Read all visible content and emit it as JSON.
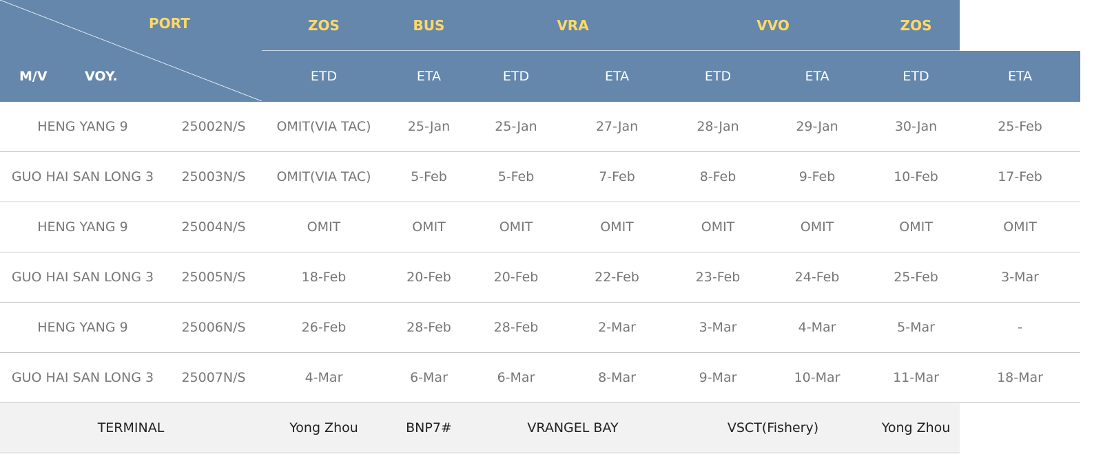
{
  "header": {
    "port_label": "PORT",
    "mv_label": "M/V",
    "voy_label": "VOY.",
    "ports": [
      {
        "code": "ZOS",
        "span": 1
      },
      {
        "code": "BUS",
        "span": 1
      },
      {
        "code": "VRA",
        "span": 2
      },
      {
        "code": "VVO",
        "span": 2
      },
      {
        "code": "ZOS",
        "span": 1
      }
    ],
    "events": [
      "ETD",
      "ETA",
      "ETD",
      "ETA",
      "ETD",
      "ETA",
      "ETD",
      "ETA"
    ]
  },
  "rows": [
    {
      "vessel": "HENG YANG 9",
      "voyage": "25002N/S",
      "times": [
        "OMIT(VIA TAC)",
        "25-Jan",
        "25-Jan",
        "27-Jan",
        "28-Jan",
        "29-Jan",
        "30-Jan",
        "25-Feb"
      ]
    },
    {
      "vessel": "GUO HAI SAN LONG 3",
      "voyage": "25003N/S",
      "times": [
        "OMIT(VIA TAC)",
        "5-Feb",
        "5-Feb",
        "7-Feb",
        "8-Feb",
        "9-Feb",
        "10-Feb",
        "17-Feb"
      ]
    },
    {
      "vessel": "HENG YANG 9",
      "voyage": "25004N/S",
      "times": [
        "OMIT",
        "OMIT",
        "OMIT",
        "OMIT",
        "OMIT",
        "OMIT",
        "OMIT",
        "OMIT"
      ]
    },
    {
      "vessel": "GUO HAI SAN LONG 3",
      "voyage": "25005N/S",
      "times": [
        "18-Feb",
        "20-Feb",
        "20-Feb",
        "22-Feb",
        "23-Feb",
        "24-Feb",
        "25-Feb",
        "3-Mar"
      ]
    },
    {
      "vessel": "HENG YANG 9",
      "voyage": "25006N/S",
      "times": [
        "26-Feb",
        "28-Feb",
        "28-Feb",
        "2-Mar",
        "3-Mar",
        "4-Mar",
        "5-Mar",
        "-"
      ]
    },
    {
      "vessel": "GUO HAI SAN LONG 3",
      "voyage": "25007N/S",
      "times": [
        "4-Mar",
        "6-Mar",
        "6-Mar",
        "8-Mar",
        "9-Mar",
        "10-Mar",
        "11-Mar",
        "18-Mar"
      ]
    }
  ],
  "terminal": {
    "label": "TERMINAL",
    "values": [
      {
        "name": "Yong Zhou",
        "span": 1
      },
      {
        "name": "BNP7#",
        "span": 1
      },
      {
        "name": "VRANGEL BAY",
        "span": 2
      },
      {
        "name": "VSCT(Fishery)",
        "span": 2
      },
      {
        "name": "Yong Zhou",
        "span": 1
      }
    ]
  },
  "colors": {
    "header_bg": "#6587ab",
    "port_text": "#ffd966",
    "header_text": "#ffffff",
    "cell_text": "#777777",
    "terminal_bg": "#f2f2f2"
  }
}
